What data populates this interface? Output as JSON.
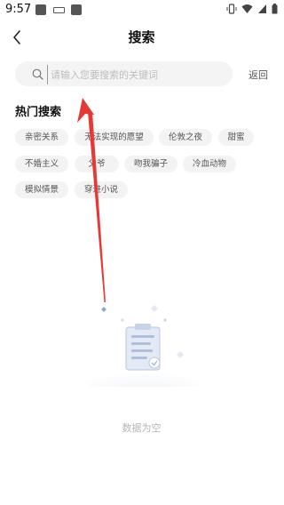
{
  "status_bar": {
    "time": "9:57",
    "icons": [
      "app-icon",
      "keyboard-icon",
      "app-icon",
      "vibrate-icon",
      "wifi-icon",
      "signal-icon",
      "battery-icon"
    ]
  },
  "header": {
    "back_icon": "chevron-left-icon",
    "title": "搜索"
  },
  "search": {
    "placeholder": "请输入您要搜索的关键词",
    "value": "",
    "icon": "search-icon",
    "return_label": "返回"
  },
  "hot_search": {
    "title": "热门搜索",
    "tags": [
      "亲密关系",
      "无法实现的愿望",
      "伦敦之夜",
      "甜蜜",
      "不婚主义",
      "父爷",
      "吻我骗子",
      "冷血动物",
      "模拟情景",
      "穿进小说"
    ]
  },
  "empty_state": {
    "icon": "clipboard-icon",
    "text": "数据为空"
  },
  "colors": {
    "accent_arrow": "#e53935",
    "tag_bg": "#f3f3f3",
    "search_bg": "#f4f4f4",
    "empty_text": "#b6b6b6"
  }
}
